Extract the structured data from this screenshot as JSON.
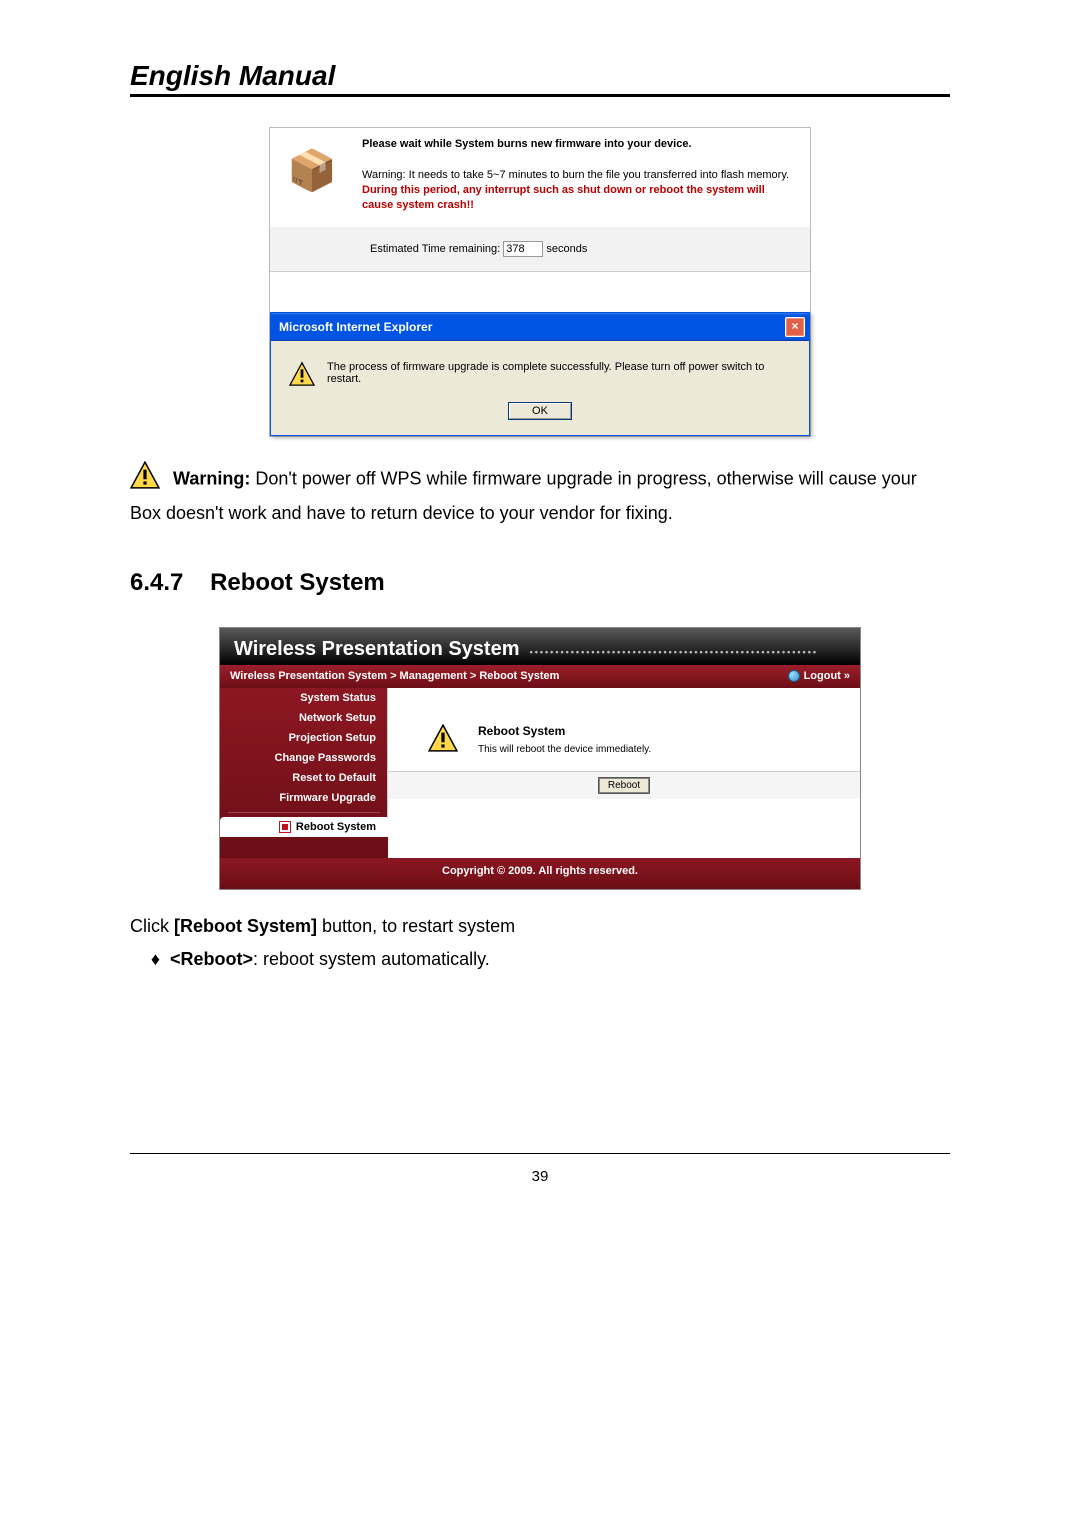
{
  "title": "English Manual",
  "fw": {
    "wait": "Please wait while System burns new firmware into your device.",
    "warn_pre": "Warning: It needs to take 5~7 minutes to burn the file you transferred into flash memory. ",
    "warn_red": "During this period, any interrupt such as shut down or reboot the system will cause system crash!!",
    "est_pre": "Estimated Time remaining: ",
    "est_val": "378",
    "est_post": " seconds"
  },
  "ie": {
    "title": "Microsoft Internet Explorer",
    "msg": "The process of firmware upgrade is complete successfully. Please turn off power switch to restart.",
    "ok": "OK"
  },
  "warning_para": {
    "label": "Warning:",
    "text": " Don't power off WPS while firmware upgrade in progress, otherwise will cause your Box doesn't work and have to return device to your vendor for fixing."
  },
  "section": {
    "num": "6.4.7",
    "title": "Reboot System"
  },
  "wps": {
    "banner": "Wireless Presentation System",
    "breadcrumb": "Wireless Presentation System > Management > Reboot System",
    "logout": "Logout »",
    "sidebar": [
      "System Status",
      "Network Setup",
      "Projection Setup",
      "Change Passwords",
      "Reset to Default",
      "Firmware Upgrade"
    ],
    "sidebar_active": "Reboot System",
    "panel_title": "Reboot System",
    "panel_sub": "This will reboot the device immediately.",
    "reboot_btn": "Reboot",
    "footer": "Copyright © 2009. All rights reserved."
  },
  "trail": {
    "line1_pre": "Click ",
    "line1_bold": "[Reboot System]",
    "line1_post": " button, to restart system",
    "bullet_bold": "<Reboot>",
    "bullet_post": ": reboot system automatically."
  },
  "page_number": "39"
}
